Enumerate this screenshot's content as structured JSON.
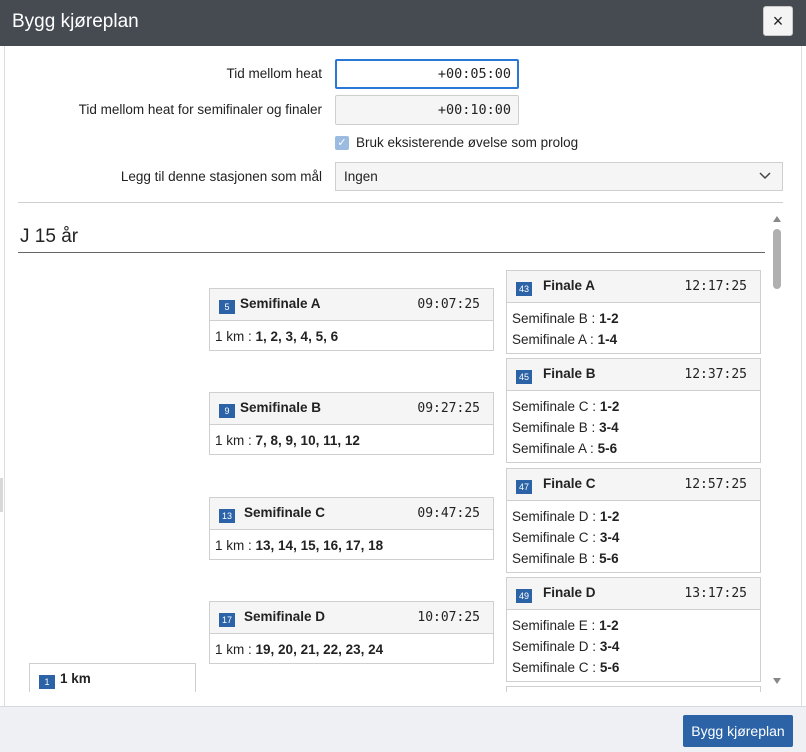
{
  "dialog": {
    "title": "Bygg kjøreplan",
    "close_glyph": "×"
  },
  "form": {
    "heat_interval_label": "Tid mellom heat",
    "heat_interval_value": "+00:05:00",
    "semifinal_interval_label": "Tid mellom heat for semifinaler og finaler",
    "semifinal_interval_value": "+00:10:00",
    "use_existing_label": "Bruk eksisterende øvelse som prolog",
    "use_existing_checked": true,
    "station_label": "Legg til denne stasjonen som mål",
    "station_value": "Ingen"
  },
  "class_title": "J 15 år",
  "prolog": {
    "number": "1",
    "name": "1 km"
  },
  "semifinals": [
    {
      "number": "5",
      "name": "Semifinale A",
      "time": "09:07:25",
      "distance": "1 km :",
      "places": "1, 2, 3, 4, 5, 6"
    },
    {
      "number": "9",
      "name": "Semifinale B",
      "time": "09:27:25",
      "distance": "1 km :",
      "places": "7, 8, 9, 10, 11, 12"
    },
    {
      "number": "13",
      "name": "Semifinale C",
      "time": "09:47:25",
      "distance": "1 km :",
      "places": "13, 14, 15, 16, 17, 18"
    },
    {
      "number": "17",
      "name": "Semifinale D",
      "time": "10:07:25",
      "distance": "1 km :",
      "places": "19, 20, 21, 22, 23, 24"
    }
  ],
  "finals": [
    {
      "number": "43",
      "name": "Finale A",
      "time": "12:17:25",
      "sources": [
        {
          "from": "Semifinale B :",
          "places": "1-2"
        },
        {
          "from": "Semifinale A :",
          "places": "1-4"
        }
      ]
    },
    {
      "number": "45",
      "name": "Finale B",
      "time": "12:37:25",
      "sources": [
        {
          "from": "Semifinale C :",
          "places": "1-2"
        },
        {
          "from": "Semifinale B :",
          "places": "3-4"
        },
        {
          "from": "Semifinale A :",
          "places": "5-6"
        }
      ]
    },
    {
      "number": "47",
      "name": "Finale C",
      "time": "12:57:25",
      "sources": [
        {
          "from": "Semifinale D :",
          "places": "1-2"
        },
        {
          "from": "Semifinale C :",
          "places": "3-4"
        },
        {
          "from": "Semifinale B :",
          "places": "5-6"
        }
      ]
    },
    {
      "number": "49",
      "name": "Finale D",
      "time": "13:17:25",
      "sources": [
        {
          "from": "Semifinale E :",
          "places": "1-2"
        },
        {
          "from": "Semifinale D :",
          "places": "3-4"
        },
        {
          "from": "Semifinale C :",
          "places": "5-6"
        }
      ]
    }
  ],
  "footer": {
    "build_label": "Bygg kjøreplan"
  },
  "colors": {
    "accent": "#2b63a6",
    "titlebar": "#464b52",
    "focus": "#2a78d6"
  }
}
